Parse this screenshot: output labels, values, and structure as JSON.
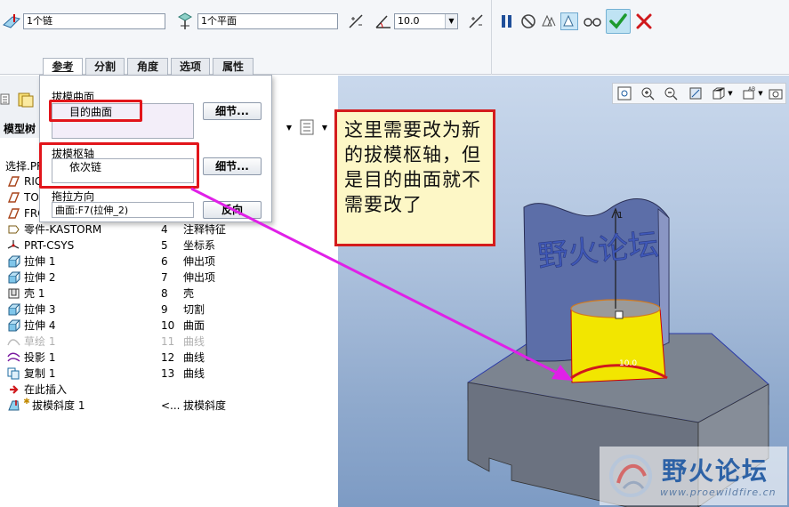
{
  "toolbar": {
    "chain_field": "1个链",
    "plane_field": "1个平面",
    "angle_value": "10.0"
  },
  "tabs": [
    {
      "label": "参考",
      "active": true
    },
    {
      "label": "分割",
      "active": false
    },
    {
      "label": "角度",
      "active": false
    },
    {
      "label": "选项",
      "active": false
    },
    {
      "label": "属性",
      "active": false
    }
  ],
  "reference_panel": {
    "draft_surface_label": "拔模曲面",
    "draft_surface_value": "目的曲面",
    "draft_hinge_label": "拔模枢轴",
    "draft_hinge_value": "依次链",
    "pull_direction_label": "拖拉方向",
    "pull_direction_value": "曲面:F7(拉伸_2)",
    "details_button": "细节...",
    "flip_button": "反向"
  },
  "model_tree": {
    "header": "模型树",
    "top_partial": [
      "选择.PR",
      "RIG",
      "TO",
      "FRO"
    ],
    "rows": [
      {
        "name": "零件-KASTORM",
        "no": "4",
        "type": "注释特征",
        "icon": "part-icon",
        "dim": false
      },
      {
        "name": "PRT-CSYS",
        "no": "5",
        "type": "坐标系",
        "icon": "csys-icon",
        "dim": false
      },
      {
        "name": "拉伸 1",
        "no": "6",
        "type": "伸出项",
        "icon": "extrude-icon",
        "dim": false
      },
      {
        "name": "拉伸 2",
        "no": "7",
        "type": "伸出项",
        "icon": "extrude-icon",
        "dim": false
      },
      {
        "name": "壳 1",
        "no": "8",
        "type": "壳",
        "icon": "shell-icon",
        "dim": false
      },
      {
        "name": "拉伸 3",
        "no": "9",
        "type": "切割",
        "icon": "extrude-icon",
        "dim": false
      },
      {
        "name": "拉伸 4",
        "no": "10",
        "type": "曲面",
        "icon": "extrude-icon",
        "dim": false
      },
      {
        "name": "草绘 1",
        "no": "11",
        "type": "曲线",
        "icon": "sketch-icon",
        "dim": true
      },
      {
        "name": "投影 1",
        "no": "12",
        "type": "曲线",
        "icon": "project-icon",
        "dim": false
      },
      {
        "name": "复制 1",
        "no": "13",
        "type": "曲线",
        "icon": "copy-icon",
        "dim": false
      },
      {
        "name": "在此插入",
        "no": "",
        "type": "",
        "icon": "insert-arrow-icon",
        "dim": false
      },
      {
        "name": "拔模斜度 1",
        "no": "<...",
        "type": "拔模斜度",
        "icon": "draft-icon",
        "dim": false
      }
    ]
  },
  "callout": {
    "text": "这里需要改为新的拔模枢轴，但是目的曲面就不需要改了"
  },
  "model_view": {
    "emboss_text": "野火论坛",
    "dimension_label": "10.0",
    "axis_number": "1"
  },
  "watermark": {
    "title": "野火论坛",
    "url": "www.proewildfire.cn"
  },
  "colors": {
    "accent_red": "#e2151b",
    "callout_bg": "#fdf7c6",
    "arrow_magenta": "#e020e8",
    "surface_yellow": "#f2e600",
    "wall_blue": "#5c6ea8"
  }
}
